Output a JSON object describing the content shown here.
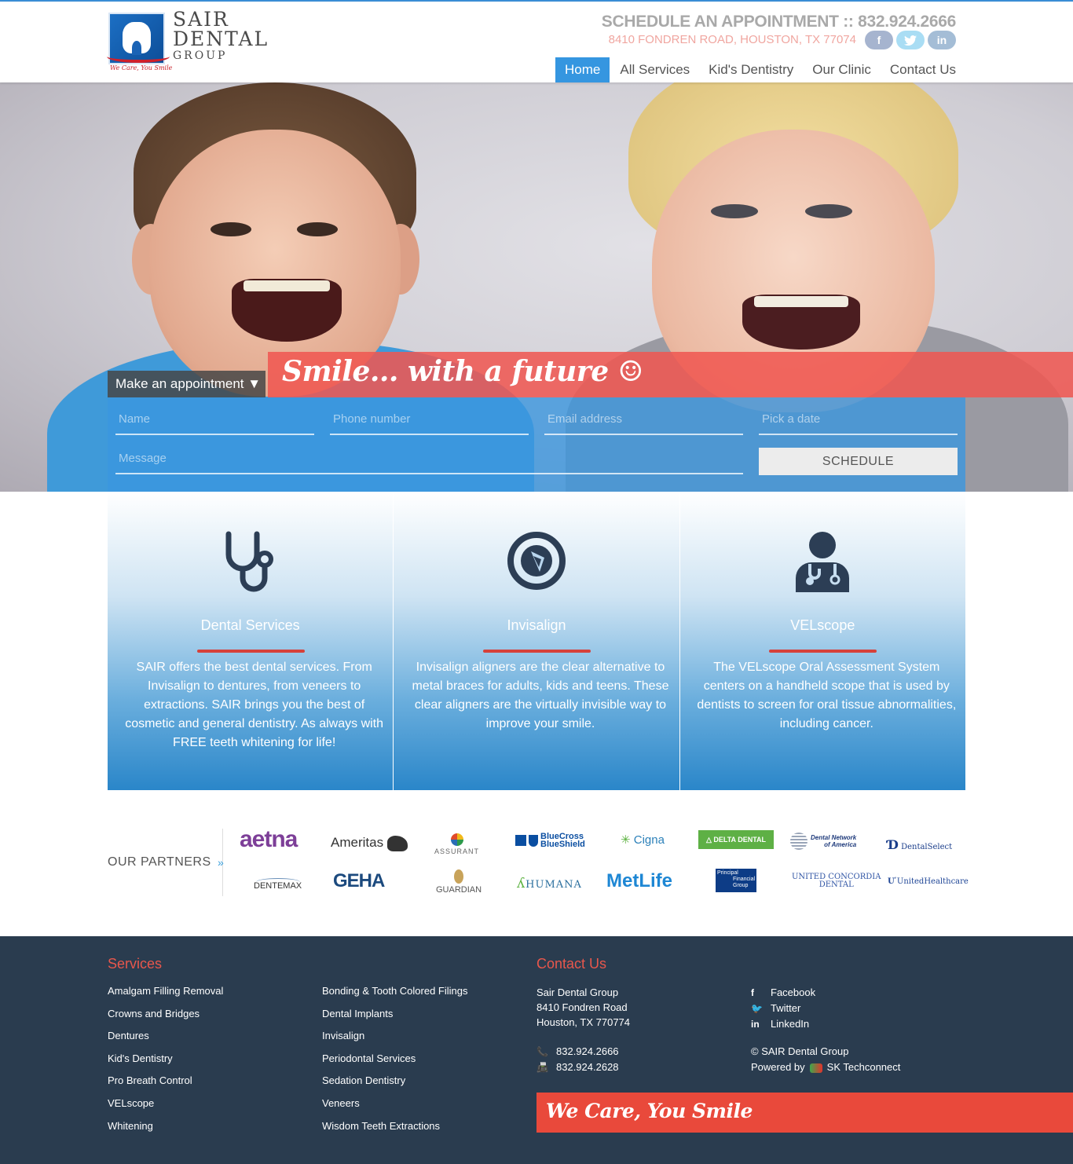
{
  "brand": {
    "name_line1": "SAIR",
    "name_line2": "DENTAL",
    "name_line3": "GROUP",
    "tagline": "We Care, You Smile",
    "colors": {
      "accent_blue": "#3596e0",
      "accent_red": "#e9493b",
      "footer_bg": "#2a3c4f"
    }
  },
  "header": {
    "appointment": "SCHEDULE AN APPOINTMENT :: 832.924.2666",
    "address": "8410 FONDREN ROAD, HOUSTON, TX 77074",
    "social": [
      {
        "icon": "facebook-icon",
        "glyph": "f"
      },
      {
        "icon": "twitter-icon",
        "glyph": "t"
      },
      {
        "icon": "linkedin-icon",
        "glyph": "in"
      }
    ]
  },
  "nav": {
    "items": [
      {
        "label": "Home",
        "active": true
      },
      {
        "label": "All Services",
        "active": false
      },
      {
        "label": "Kid's Dentistry",
        "active": false
      },
      {
        "label": "Our Clinic",
        "active": false
      },
      {
        "label": "Contact Us",
        "active": false
      }
    ]
  },
  "hero": {
    "banner": "Smile... with a future ☺",
    "make_appointment": "Make an appointment ▼",
    "form": {
      "name_placeholder": "Name",
      "phone_placeholder": "Phone number",
      "email_placeholder": "Email address",
      "date_placeholder": "Pick a date",
      "message_placeholder": "Message",
      "submit": "SCHEDULE"
    }
  },
  "services": [
    {
      "icon": "stethoscope-icon",
      "title": "Dental Services",
      "text": "SAIR offers the best dental services. From Invisalign to dentures, from veneers to extractions. SAIR brings you the best of cosmetic and general dentistry. As always with FREE teeth whitening for life!"
    },
    {
      "icon": "invisalign-icon",
      "title": "Invisalign",
      "text": "Invisalign aligners are the clear alternative to metal braces for adults, kids and teens. These clear aligners are the virtually invisible way to improve your smile."
    },
    {
      "icon": "doctor-icon",
      "title": "VELscope",
      "text": "The VELscope Oral Assessment System centers on a handheld scope that is used by dentists to screen for oral tissue abnormalities, including cancer."
    }
  ],
  "partners": {
    "label": "OUR PARTNERS",
    "arrow": "»",
    "logos": {
      "aetna": "aetna",
      "ameritas": "Ameritas",
      "assurant": "ASSURANT",
      "bcbs_1": "BlueCross",
      "bcbs_2": "BlueShield",
      "cigna": "Cigna",
      "delta": "DELTA DENTAL",
      "dna_1": "Dental Network",
      "dna_2": "of America",
      "dselect": "DentalSelect",
      "dentemax": "DENTEMAX",
      "geha": "GEHA",
      "guardian": "GUARDIAN",
      "humana": "HUMANA",
      "metlife": "MetLife",
      "principal_1": "Principal",
      "principal_2": "Financial",
      "principal_3": "Group",
      "ucd_1": "UNITED CONCORDIA",
      "ucd_2": "DENTAL",
      "uhc": "UnitedHealthcare"
    }
  },
  "footer": {
    "services_heading": "Services",
    "services_col1": [
      "Amalgam Filling Removal",
      "Crowns and Bridges",
      "Dentures",
      "Kid's Dentistry",
      "Pro Breath Control",
      "VELscope",
      "Whitening"
    ],
    "services_col2": [
      "Bonding & Tooth Colored Filings",
      "Dental Implants",
      "Invisalign",
      "Periodontal Services",
      "Sedation Dentistry",
      "Veneers",
      "Wisdom Teeth Extractions"
    ],
    "contact_heading": "Contact Us",
    "contact_name": "Sair Dental Group",
    "contact_street": "8410 Fondren Road",
    "contact_city": "Houston, TX 770774",
    "phone": "832.924.2666",
    "fax": "832.924.2628",
    "social": [
      "Facebook",
      "Twitter",
      "LinkedIn"
    ],
    "copyright": "© SAIR Dental Group",
    "powered_by": "Powered by",
    "powered_name": "SK Techconnect",
    "tagline": "We Care, You Smile"
  }
}
